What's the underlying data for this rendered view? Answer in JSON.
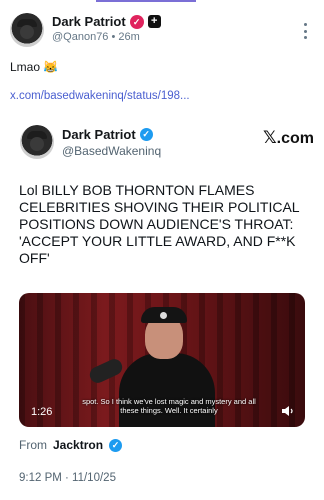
{
  "post": {
    "display_name": "Dark Patriot",
    "handle_time": "@Qanon76 • 26m",
    "text": "Lmao 😹",
    "link": "x.com/basedwakeninq/status/198...",
    "square_badge": "+"
  },
  "card": {
    "display_name": "Dark Patriot",
    "handle": "@BasedWakeninq",
    "brand": ".com",
    "brand_x": "𝕏",
    "text": "Lol BILLY BOB THORNTON FLAMES CELEBRITIES SHOVING THEIR POLITICAL POSITIONS DOWN AUDIENCE'S THROAT: 'ACCEPT YOUR LITTLE AWARD, AND F**K OFF'",
    "video": {
      "subtitle": "spot. So I think we've lost magic and mystery and all these things. Well. It certainly",
      "duration": "1:26"
    },
    "from_label": "From",
    "from_name": "Jacktron",
    "date": "9:12 PM · 11/10/25"
  },
  "colors": {
    "accent": "#7b6fd6",
    "link": "#4a5fd0",
    "verified_blue": "#1d9bf0",
    "verified_pink": "#e0245e"
  },
  "icons": [
    "avatar",
    "verified-badge-icon",
    "plus-square-icon",
    "more-vertical-icon",
    "x-logo-icon",
    "volume-icon"
  ]
}
